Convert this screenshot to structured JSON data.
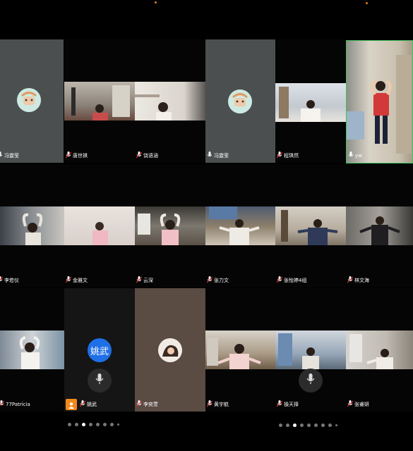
{
  "colors": {
    "avatar_blue": "#1f6fe6",
    "active_border": "#3fc35c",
    "share_orange": "#f08a1c"
  },
  "icons": {
    "mic": "mic-icon",
    "avatar": "avatar-icon"
  },
  "left_page": {
    "participants": [
      {
        "name": "冯震莹",
        "state": "avatar"
      },
      {
        "name": "唐世祺",
        "state": "video"
      },
      {
        "name": "饶语涵",
        "state": "video"
      },
      {
        "name": "李若仪",
        "state": "video"
      },
      {
        "name": "金雅文",
        "state": "video"
      },
      {
        "name": "云深",
        "state": "video"
      },
      {
        "name": "77Patricia",
        "state": "video"
      },
      {
        "name": "姚武",
        "state": "audio-only",
        "avatar_text": "姚武"
      },
      {
        "name": "李奕萱",
        "state": "avatar"
      }
    ],
    "pagination": {
      "dots": 8,
      "active_index": 2
    }
  },
  "right_page": {
    "participants": [
      {
        "name": "冯震莹",
        "state": "avatar"
      },
      {
        "name": "程琪然",
        "state": "video"
      },
      {
        "name": "yw",
        "state": "video-active-speaker"
      },
      {
        "name": "张力文",
        "state": "video"
      },
      {
        "name": "张怡婷4组",
        "state": "video"
      },
      {
        "name": "林文海",
        "state": "video"
      },
      {
        "name": "黄宇航",
        "state": "video"
      },
      {
        "name": "操天择",
        "state": "video"
      },
      {
        "name": "张睿妍",
        "state": "video"
      }
    ],
    "pagination": {
      "dots": 9,
      "active_index": 2
    }
  }
}
